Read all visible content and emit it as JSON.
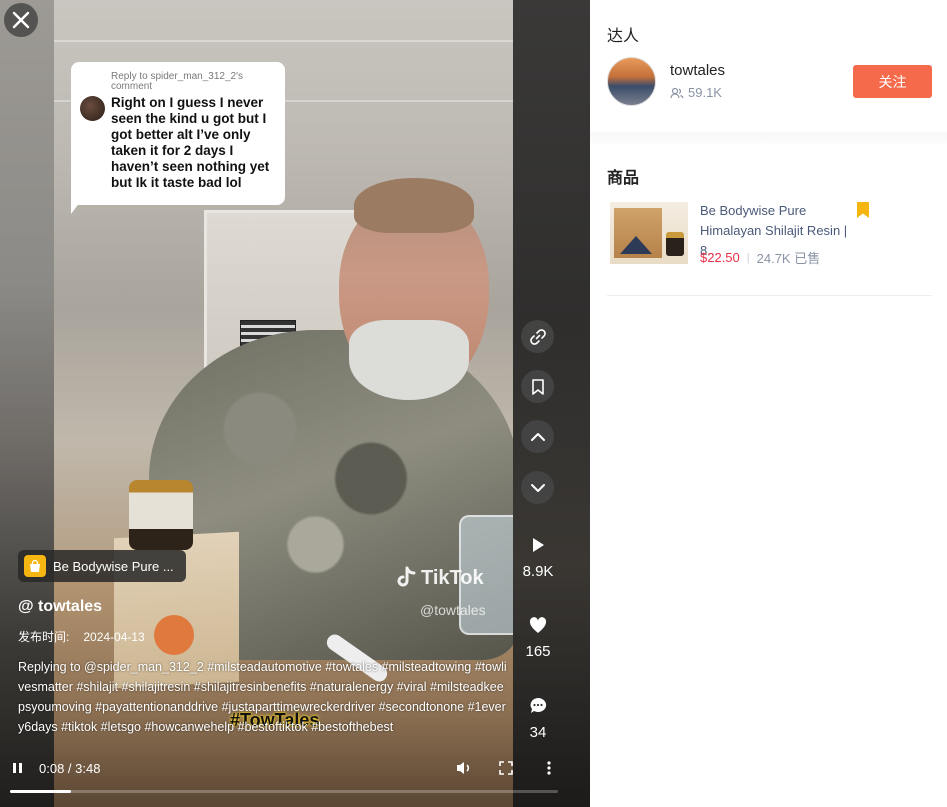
{
  "video": {
    "reply": {
      "header": "Reply to spider_man_312_2's comment",
      "text": "Right on I guess I never seen the kind u got but I got better alt I’ve only taken it for 2 days I haven’t seen nothing yet but Ik it taste bad lol"
    },
    "product_chip": "Be Bodywise Pure ...",
    "watermark": {
      "brand": "TikTok",
      "handle": "@towtales"
    },
    "author": "@ towtales",
    "publish_label": "发布时间:",
    "publish_date": "2024-04-13",
    "description": "Replying to @spider_man_312_2 #milsteadautomotive #towtales #milsteadtowing #towlivesmatter #shilajit #shilajitresin #shilajitresinbenefits #naturalenergy #viral #milsteadkeepsyoumoving #payattentionanddrive #justaparttimewreckerdriver #secondtonone #1every6days #tiktok #letsgo #howcanwehelp #bestoftiktok #bestofthebest",
    "caption_overlay": "#TowTales",
    "stats": {
      "plays": "8.9K",
      "likes": "165",
      "comments": "34"
    },
    "time": "0:08 / 3:48",
    "progress": 0.037
  },
  "panel": {
    "creator_section": "达人",
    "creator": {
      "name": "towtales",
      "fans": "59.1K",
      "follow_label": "关注"
    },
    "products_section": "商品",
    "product": {
      "name": "Be Bodywise Pure Himalayan Shilajit Resin | 8...",
      "price": "$22.50",
      "sold": "24.7K 已售"
    }
  },
  "colors": {
    "follow": "#f56a4b",
    "price": "#e8334a",
    "bookmark": "#f6b612"
  }
}
